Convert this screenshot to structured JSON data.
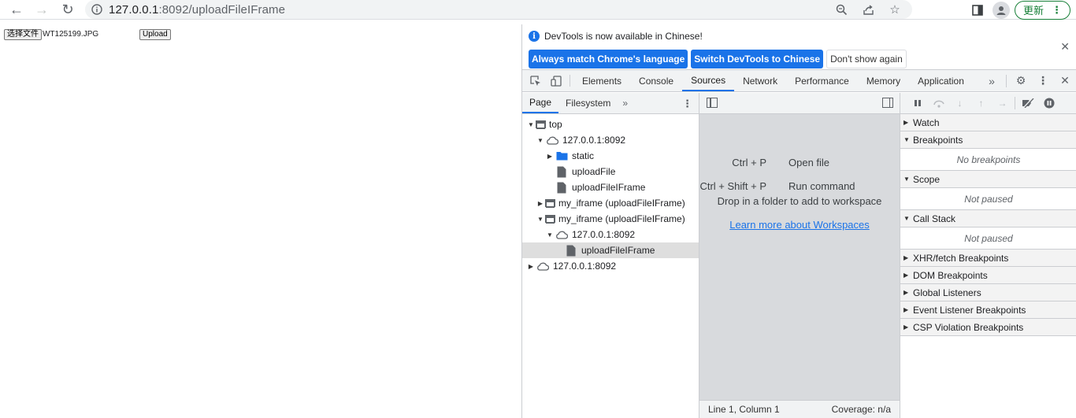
{
  "browser": {
    "url_host": "127.0.0.1",
    "url_path": ":8092/uploadFileIFrame",
    "update_label": "更新"
  },
  "page": {
    "file_button_label": "选择文件",
    "file_name": "WT125199.JPG",
    "upload_label": "Upload"
  },
  "devtools": {
    "infobar": {
      "message": "DevTools is now available in Chinese!",
      "buttons": [
        "Always match Chrome's language",
        "Switch DevTools to Chinese",
        "Don't show again"
      ]
    },
    "tabs": [
      "Elements",
      "Console",
      "Sources",
      "Network",
      "Performance",
      "Memory",
      "Application"
    ],
    "active_tab": "Sources",
    "navigator": {
      "tabs": [
        "Page",
        "Filesystem"
      ],
      "tree": [
        {
          "label": "top",
          "icon": "frame-icon",
          "arrow": "down",
          "indent": 0
        },
        {
          "label": "127.0.0.1:8092",
          "icon": "cloud-icon",
          "arrow": "down",
          "indent": 1
        },
        {
          "label": "static",
          "icon": "folder-icon",
          "arrow": "right",
          "indent": 2
        },
        {
          "label": "uploadFile",
          "icon": "file-icon",
          "arrow": "",
          "indent": 2
        },
        {
          "label": "uploadFileIFrame",
          "icon": "file-icon",
          "arrow": "",
          "indent": 2
        },
        {
          "label": "my_iframe (uploadFileIFrame)",
          "icon": "frame-icon",
          "arrow": "right",
          "indent": 1
        },
        {
          "label": "my_iframe (uploadFileIFrame)",
          "icon": "frame-icon",
          "arrow": "down",
          "indent": 1
        },
        {
          "label": "127.0.0.1:8092",
          "icon": "cloud-icon",
          "arrow": "down",
          "indent": 2
        },
        {
          "label": "uploadFileIFrame",
          "icon": "file-icon",
          "arrow": "",
          "indent": 3,
          "selected": true
        },
        {
          "label": "127.0.0.1:8092",
          "icon": "cloud-icon",
          "arrow": "right",
          "indent": 0
        }
      ]
    },
    "editor": {
      "shortcuts": [
        {
          "keys": "Ctrl + P",
          "action": "Open file"
        },
        {
          "keys": "Ctrl + Shift + P",
          "action": "Run command"
        }
      ],
      "drop_message": "Drop in a folder to add to workspace",
      "learn_link": "Learn more about Workspaces",
      "status_position": "Line 1, Column 1",
      "status_coverage": "Coverage: n/a"
    },
    "debugger": {
      "watch": "Watch",
      "breakpoints": "Breakpoints",
      "no_breakpoints": "No breakpoints",
      "scope": "Scope",
      "scope_body": "Not paused",
      "call_stack": "Call Stack",
      "call_stack_body": "Not paused",
      "collapsed_panes": [
        "XHR/fetch Breakpoints",
        "DOM Breakpoints",
        "Global Listeners",
        "Event Listener Breakpoints",
        "CSP Violation Breakpoints"
      ]
    }
  }
}
